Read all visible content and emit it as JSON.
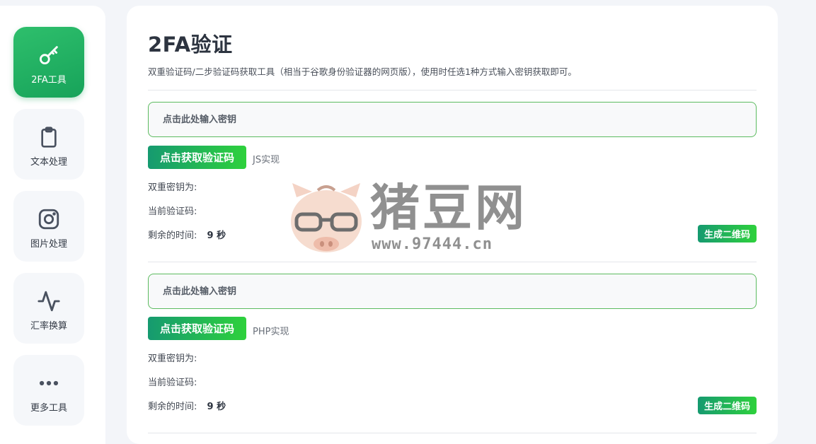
{
  "sidebar": {
    "items": [
      {
        "label": "2FA工具",
        "icon": "key-icon",
        "active": true
      },
      {
        "label": "文本处理",
        "icon": "clipboard-icon",
        "active": false
      },
      {
        "label": "图片处理",
        "icon": "instagram-icon",
        "active": false
      },
      {
        "label": "汇率换算",
        "icon": "activity-icon",
        "active": false
      },
      {
        "label": "更多工具",
        "icon": "more-icon",
        "active": false
      }
    ]
  },
  "page": {
    "title": "2FA验证",
    "description": "双重验证码/二步验证码获取工具（相当于谷歌身份验证器的网页版），使用时任选1种方式输入密钥获取即可。"
  },
  "panels": [
    {
      "input_placeholder": "点击此处输入密钥",
      "get_code_label": "点击获取验证码",
      "impl_label": "JS实现",
      "secret_label": "双重密钥为:",
      "code_label": "当前验证码:",
      "time_label": "剩余的时间:",
      "time_value": "9 秒",
      "qr_label": "生成二维码"
    },
    {
      "input_placeholder": "点击此处输入密钥",
      "get_code_label": "点击获取验证码",
      "impl_label": "PHP实现",
      "secret_label": "双重密钥为:",
      "code_label": "当前验证码:",
      "time_label": "剩余的时间:",
      "time_value": "9 秒",
      "qr_label": "生成二维码"
    }
  ],
  "watermark": {
    "brand": "猪豆网",
    "url": "www.97444.cn"
  },
  "colors": {
    "accent_start": "#169a70",
    "accent_end": "#2ed13c",
    "input_border": "#5cbb5f",
    "active_nav": "#1fae60"
  }
}
